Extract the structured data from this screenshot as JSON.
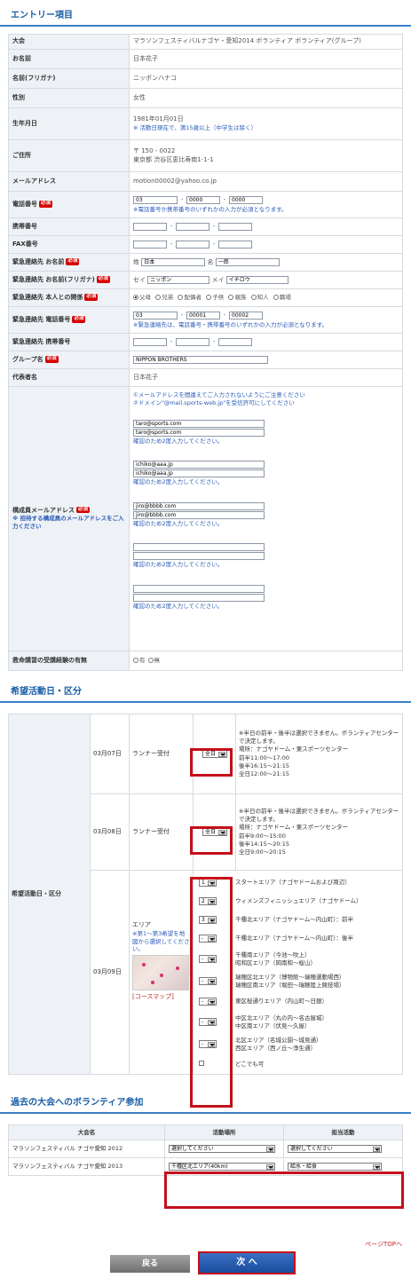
{
  "entry": {
    "title": "エントリー項目",
    "tournament": {
      "label": "大会",
      "value": "マラソンフェスティバルナゴヤ・愛知2014 ボランティア ボランティア(グループ)"
    },
    "name": {
      "label": "お名前",
      "value": "日本花子"
    },
    "kana": {
      "label": "名前(フリガナ)",
      "value": "ニッポンハナコ"
    },
    "gender": {
      "label": "性別",
      "value": "女性"
    },
    "birth": {
      "label": "生年月日",
      "value": "1981年01月01日",
      "note": "※ 活動日現在で、満15歳以上（中学生は除く）"
    },
    "address": {
      "label": "ご住所",
      "zip": "〒 150 - 0022",
      "line": "東京都 渋谷区恵比寿南1-1-1"
    },
    "email": {
      "label": "メールアドレス",
      "value": "motion00002@yahoo.co.jp"
    },
    "phone": {
      "label": "電話番号",
      "p1": "03",
      "p2": "0000",
      "p3": "0000",
      "note": "※電話番号か携帯番号のいずれかの入力が必須となります。"
    },
    "mobile": {
      "label": "携帯番号"
    },
    "fax": {
      "label": "FAX番号"
    },
    "emg_name": {
      "label": "緊急連絡先 お名前",
      "sei_label": "姓",
      "sei": "日本",
      "mei_label": "名",
      "mei": "一郎"
    },
    "emg_kana": {
      "label": "緊急連絡先 お名前(フリガナ)",
      "sei_label": "セイ",
      "sei": "ニッポン",
      "mei_label": "メイ",
      "mei": "イチロウ"
    },
    "emg_rel": {
      "label": "緊急連絡先 本人との関係",
      "options": [
        "父母",
        "兄弟",
        "配偶者",
        "子供",
        "親族",
        "知人",
        "職場"
      ]
    },
    "emg_phone": {
      "label": "緊急連絡先 電話番号",
      "p1": "03",
      "p2": "00001",
      "p3": "00002",
      "note": "※緊急連絡先は、電話番号・携帯番号のいずれかの入力が必須となります。"
    },
    "emg_mobile": {
      "label": "緊急連絡先 携帯番号"
    },
    "group": {
      "label": "グループ名",
      "value": "NIPPON BROTHERS"
    },
    "rep": {
      "label": "代表者名",
      "value": "日本花子"
    },
    "members": {
      "label": "構成員メールアドレス",
      "label_note": "※ 招待する構成員のメールアドレスをご入力ください",
      "note1": "①メールアドレスを間違えてご入力されないようにご注意ください",
      "note2": "②ドメイン\"@mail.sports-web.jp\"を受信許可にしてください",
      "confirm": "確認のため2度入力してください。",
      "emails": [
        "taro@sports.com",
        "ichiko@aaa.jp",
        "jiro@bbbb.com",
        "",
        ""
      ]
    },
    "firstaid": {
      "label": "救命講習の受講経験の有無",
      "yes": "有",
      "no": "無"
    },
    "required": "必須"
  },
  "activity": {
    "title": "希望活動日・区分",
    "row_label": "希望活動日・区分",
    "day1": {
      "date": "03月07日",
      "type": "ランナー受付",
      "select": "全日",
      "notes": [
        "※半日の前半・後半は選択できません。ボランティアセンターで決定します。",
        "場所：ナゴヤドーム・東スポーツセンター",
        "前半11:00～17:00",
        "後半16:15～21:15",
        "全日12:00～21:15"
      ]
    },
    "day2": {
      "date": "03月08日",
      "type": "ランナー受付",
      "select": "全日",
      "notes": [
        "※半日の前半・後半は選択できません。ボランティアセンターで決定します。",
        "場所：ナゴヤドーム・東スポーツセンター",
        "前半9:00～15:00",
        "後半14:15～20:15",
        "全日9:00～20:15"
      ]
    },
    "day3": {
      "date": "03月09日",
      "type": "エリア",
      "note": "※第1～第3希望を地図から選択してください。",
      "map_link": "[コースマップ]",
      "options": [
        {
          "sel": "1",
          "labels": [
            "スタートエリア（ナゴヤドームおよび周辺）"
          ]
        },
        {
          "sel": "2",
          "labels": [
            "ウィメンズフィニッシュエリア（ナゴヤドーム）"
          ]
        },
        {
          "sel": "3",
          "labels": [
            "千種北エリア（ナゴヤドーム～内山町）：前半"
          ]
        },
        {
          "sel": "-",
          "labels": [
            "千種北エリア（ナゴヤドーム～内山町）：後半"
          ]
        },
        {
          "sel": "-",
          "labels": [
            "千種南エリア（今池～吹上）",
            "昭和区エリア（岡南和～桜山）"
          ]
        },
        {
          "sel": "-",
          "labels": [
            "瑞穂区北エリア（博物館～瑞穂運動場西）",
            "瑞穂区南エリア（堀田～瑞穂陸上競技場）"
          ]
        },
        {
          "sel": "-",
          "labels": [
            "東区桜通りエリア（内山町～日銀）"
          ]
        },
        {
          "sel": "-",
          "labels": [
            "中区北エリア（丸の内～名古屋城）",
            "中区南エリア（伏見～久屋）"
          ]
        },
        {
          "sel": "-",
          "labels": [
            "北区エリア（名城公園～城見通）",
            "西区エリア（西ノ丘～浄生通）"
          ]
        }
      ],
      "anywhere": "どこでも可"
    }
  },
  "past": {
    "title": "過去の大会へのボランティア参加",
    "h_name": "大会名",
    "h_place": "活動場所",
    "h_role": "担当活動",
    "rows": [
      {
        "name": "マラソンフェスティバル ナゴヤ愛知 2012",
        "place": "選択してください",
        "role": "選択してください"
      },
      {
        "name": "マラソンフェスティバル ナゴヤ愛知 2013",
        "place": "千種区北エリア(40km)",
        "role": "給水・給食"
      }
    ]
  },
  "footer": {
    "page_top": "ページTOPへ",
    "back": "戻る",
    "next": "次 へ"
  }
}
